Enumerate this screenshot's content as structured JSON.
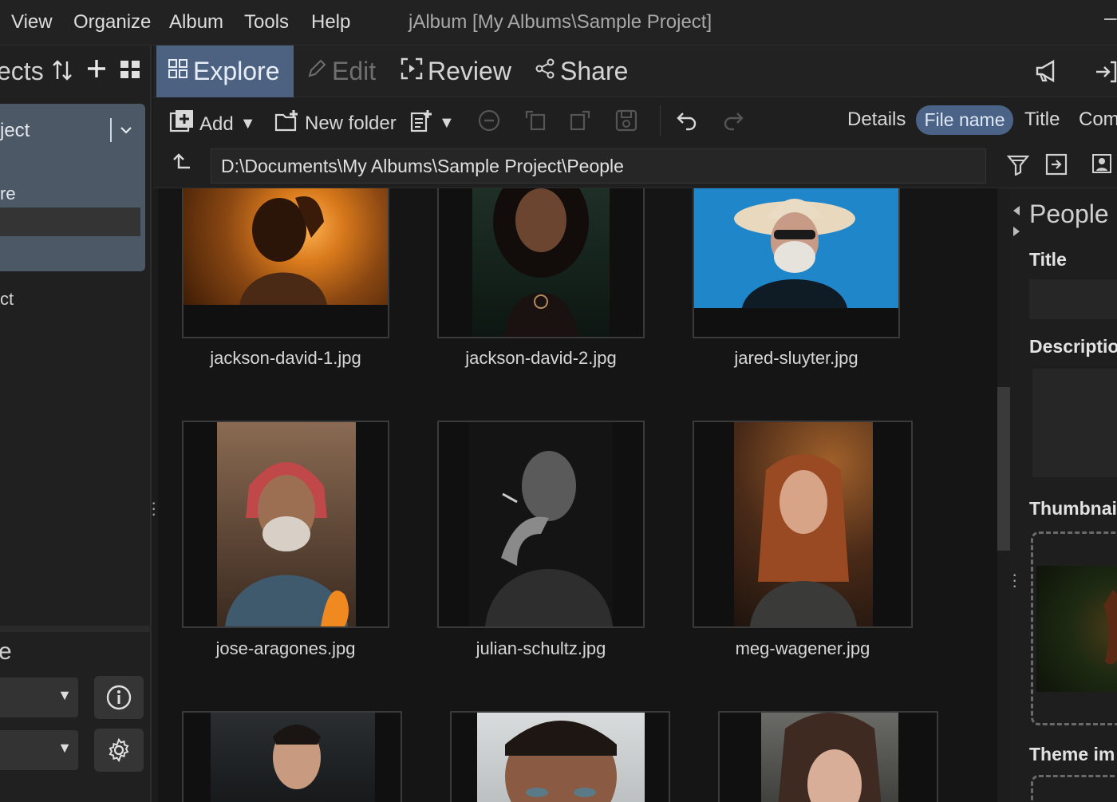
{
  "menu": [
    "View",
    "Organize",
    "Album",
    "Tools",
    "Help"
  ],
  "app_title": "jAlbum [My Albums\\Sample Project]",
  "window_control": "–",
  "left": {
    "header": "ects",
    "project_name": "ject",
    "project_sub": "re",
    "project_2": "ct",
    "bottom_title": "e"
  },
  "modes": [
    {
      "label": "Explore",
      "active": true
    },
    {
      "label": "Edit",
      "active": false
    },
    {
      "label": "Review",
      "active": false
    },
    {
      "label": "Share",
      "active": false
    }
  ],
  "toolbar": {
    "add": "Add",
    "new_folder": "New folder",
    "details": "Details",
    "file_name": "File name",
    "title": "Title",
    "comment": "Com"
  },
  "path": "D:\\Documents\\My Albums\\Sample Project\\People",
  "images": [
    {
      "name": "jackson-david-1.jpg"
    },
    {
      "name": "jackson-david-2.jpg"
    },
    {
      "name": "jared-sluyter.jpg"
    },
    {
      "name": "jose-aragones.jpg"
    },
    {
      "name": "julian-schultz.jpg"
    },
    {
      "name": "meg-wagener.jpg"
    },
    {
      "name": ""
    },
    {
      "name": ""
    },
    {
      "name": ""
    }
  ],
  "right": {
    "folder_name": "People",
    "title_label": "Title",
    "description_label": "Descriptio",
    "thumbnail_label": "Thumbnai",
    "theme_label": "Theme im"
  },
  "colors": {
    "accent": "#4d6180",
    "sort_active": "#4a6387",
    "background": "#151515"
  }
}
